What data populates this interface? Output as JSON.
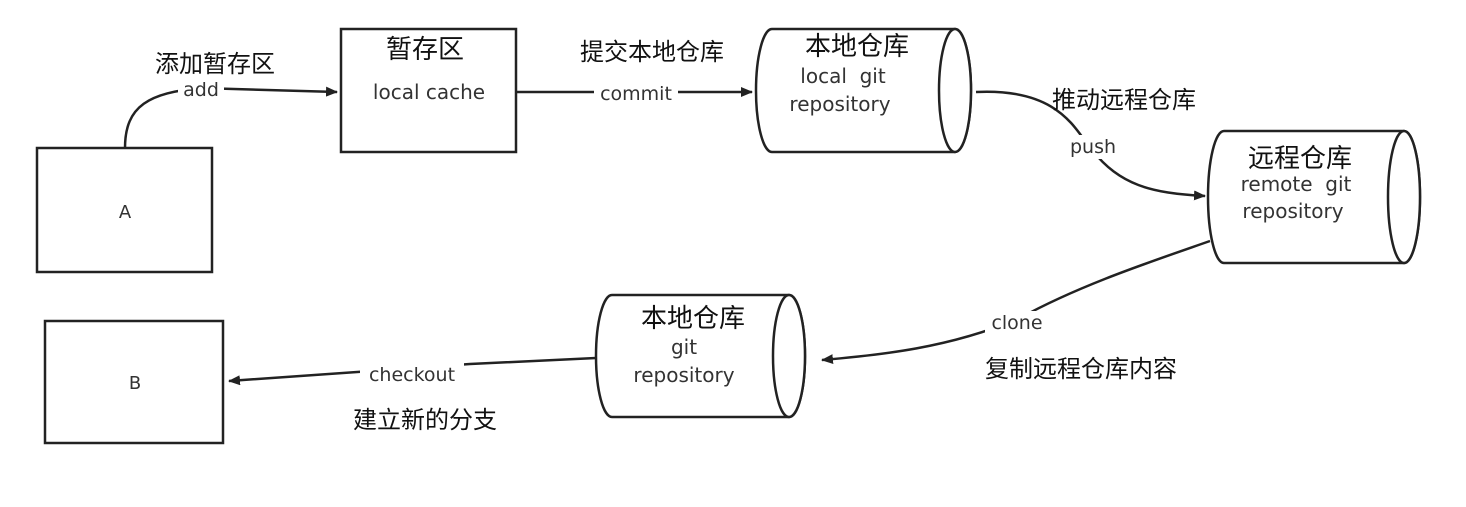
{
  "nodes": {
    "a": {
      "label": "A"
    },
    "b": {
      "label": "B"
    },
    "cache": {
      "title": "暂存区",
      "subtitle": "local cache"
    },
    "local_repo": {
      "title": "本地仓库",
      "line1": "local  git",
      "line2": "repository"
    },
    "remote_repo": {
      "title": "远程仓库",
      "line1": "remote  git",
      "line2": "repository"
    },
    "local_repo2": {
      "title": "本地仓库",
      "line1": "git",
      "line2": "repository"
    }
  },
  "edges": {
    "add": {
      "label": "add",
      "caption": "添加暂存区"
    },
    "commit": {
      "label": "commit",
      "caption": "提交本地仓库"
    },
    "push": {
      "label": "push",
      "caption": "推动远程仓库"
    },
    "clone": {
      "label": "clone",
      "caption": "复制远程仓库内容"
    },
    "checkout": {
      "label": "checkout",
      "caption": "建立新的分支"
    }
  },
  "colors": {
    "stroke": "#222222",
    "text_cn": "#111111",
    "text_en": "#333333"
  }
}
